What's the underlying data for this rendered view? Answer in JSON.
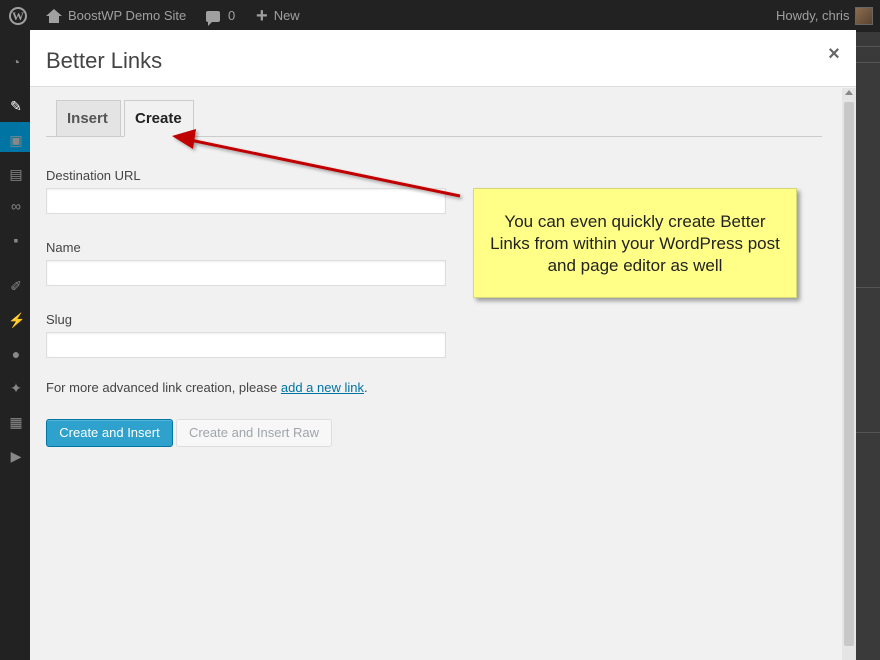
{
  "admin_bar": {
    "site_name": "BoostWP Demo Site",
    "comments_count": "0",
    "new_label": "New",
    "greeting": "Howdy, chris"
  },
  "modal": {
    "title": "Better Links",
    "close_symbol": "×",
    "tabs": [
      {
        "label": "Insert",
        "active": false
      },
      {
        "label": "Create",
        "active": true
      }
    ],
    "fields": {
      "destination_url": {
        "label": "Destination URL",
        "value": ""
      },
      "name": {
        "label": "Name",
        "value": ""
      },
      "slug": {
        "label": "Slug",
        "value": ""
      }
    },
    "help": {
      "prefix": "For more advanced link creation, please ",
      "link_text": "add a new link",
      "suffix": "."
    },
    "buttons": {
      "create_insert": "Create and Insert",
      "create_insert_raw": "Create and Insert Raw"
    }
  },
  "annotation": {
    "text": "You can even quickly create Better Links from within your WordPress post and page editor as well"
  },
  "colors": {
    "primary_button": "#2ea2cc",
    "link": "#0074a2",
    "callout_bg": "#ffff88",
    "arrow": "#c00000"
  }
}
